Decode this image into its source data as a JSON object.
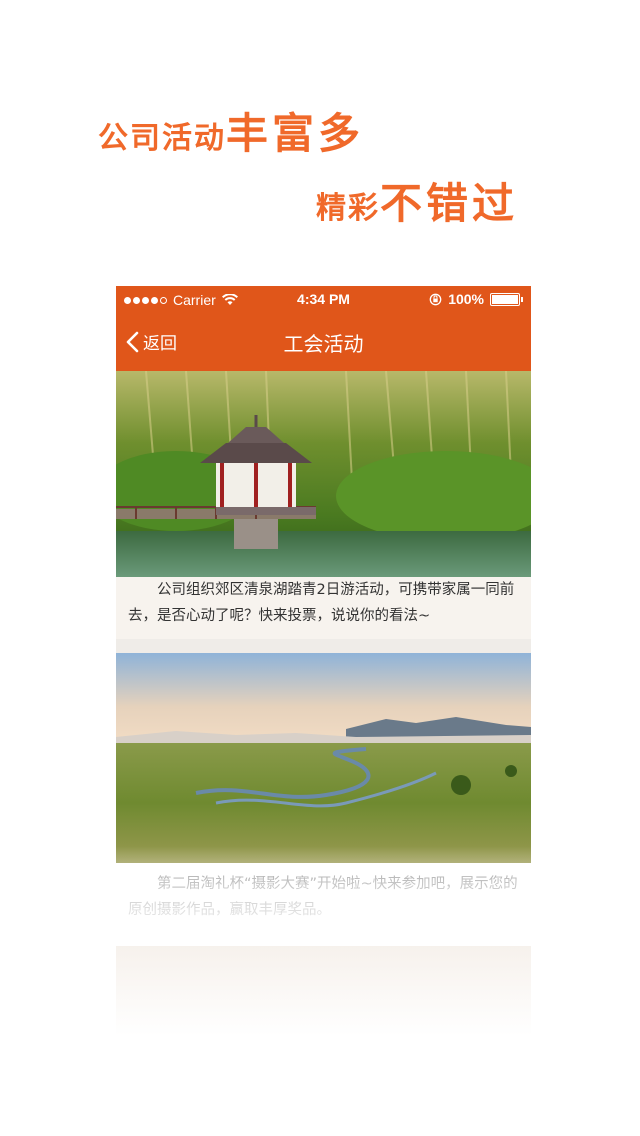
{
  "promo": {
    "line1_small": "公司活动",
    "line1_big": "丰富多",
    "line2_small": "精彩",
    "line2_big": "不错过"
  },
  "status_bar": {
    "carrier": "Carrier",
    "time": "4:34 PM",
    "battery": "100%"
  },
  "nav": {
    "back_label": "返回",
    "title": "工会活动"
  },
  "activities": [
    {
      "description": "公司组织郊区清泉湖踏青2日游活动，可携带家属一同前去，是否心动了呢？快来投票，说说你的看法~"
    },
    {
      "description": "第二届淘礼杯“摄影大赛”开始啦~快来参加吧，展示您的原创摄影作品，赢取丰厚奖品。"
    }
  ],
  "colors": {
    "accent": "#e0561a",
    "promo_text": "#f0692a"
  }
}
